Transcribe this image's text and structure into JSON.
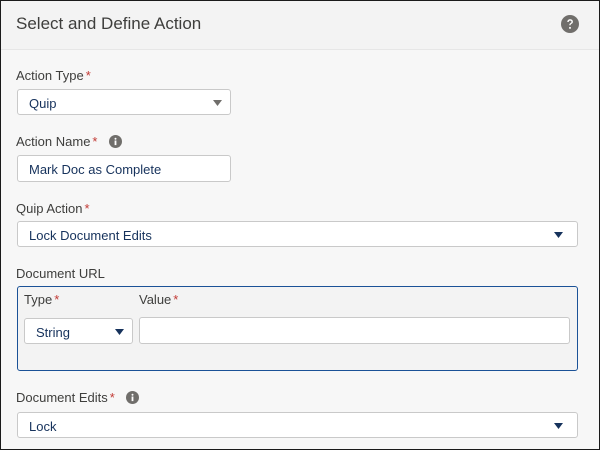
{
  "header": {
    "title": "Select and Define Action",
    "help_icon": "question-circle-icon"
  },
  "form": {
    "required_marker": "*",
    "action_type": {
      "label": "Action Type",
      "value": "Quip"
    },
    "action_name": {
      "label": "Action Name",
      "value": "Mark Doc as Complete",
      "info_icon": "info-circle-icon"
    },
    "quip_action": {
      "label": "Quip Action",
      "value": "Lock Document Edits"
    },
    "document_url": {
      "label": "Document URL",
      "type_label": "Type",
      "type_value": "String",
      "value_label": "Value",
      "value_value": ""
    },
    "document_edits": {
      "label": "Document Edits",
      "value": "Lock",
      "info_icon": "info-circle-icon"
    }
  },
  "colors": {
    "required": "#c23934",
    "input_text": "#16325c",
    "focus_border": "#1b5297",
    "icon": "#706e6b"
  }
}
